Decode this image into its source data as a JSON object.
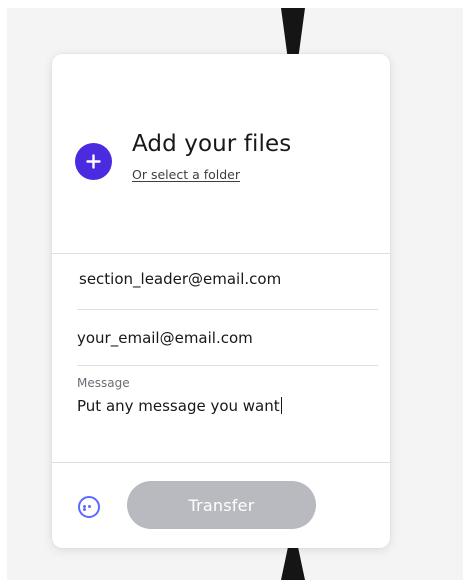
{
  "uploader": {
    "title": "Add your files",
    "folder_link": "Or select a folder",
    "add_icon": "plus-icon",
    "accent_color": "#4b2ae0"
  },
  "form": {
    "to_value": "section_leader@email.com",
    "from_value": "your_email@email.com",
    "message_label": "Message",
    "message_value": "Put any message you want"
  },
  "footer": {
    "more_icon": "more-options-icon",
    "transfer_label": "Transfer",
    "transfer_color": "#b8babf"
  }
}
